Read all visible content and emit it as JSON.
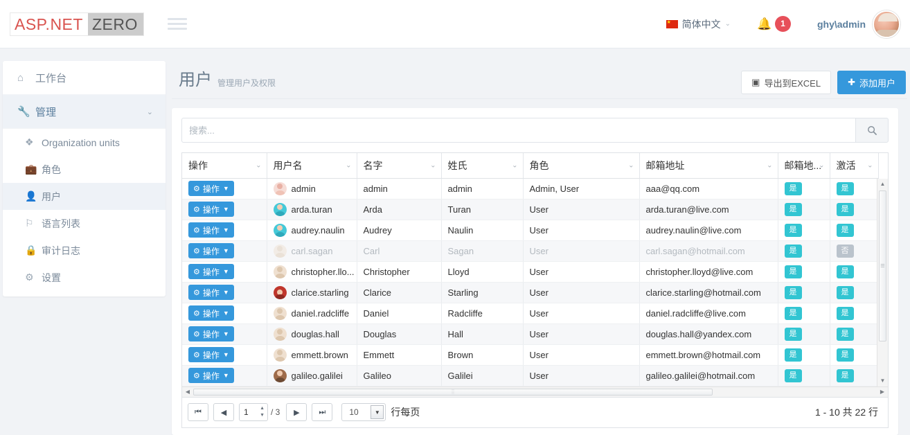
{
  "header": {
    "logo_primary": "ASP.NET",
    "logo_secondary": "ZERO",
    "menu_icon": "hamburger-icon",
    "language": {
      "label": "简体中文",
      "flag": "cn-flag-icon",
      "caret": "⌄"
    },
    "notifications": {
      "icon": "bell-icon",
      "count": "1"
    },
    "user": {
      "name": "ghy\\admin",
      "avatar": "user-avatar"
    }
  },
  "sidebar": {
    "items": [
      {
        "label": "工作台",
        "icon": "home-icon",
        "active": false
      },
      {
        "label": "管理",
        "icon": "wrench-icon",
        "active": true,
        "chevron": "⌄"
      }
    ],
    "subitems": [
      {
        "label": "Organization units",
        "icon": "layers-icon",
        "active": false
      },
      {
        "label": "角色",
        "icon": "briefcase-icon",
        "active": false
      },
      {
        "label": "用户",
        "icon": "users-icon",
        "active": true
      },
      {
        "label": "语言列表",
        "icon": "flag-icon",
        "active": false
      },
      {
        "label": "审计日志",
        "icon": "lock-icon",
        "active": false
      },
      {
        "label": "设置",
        "icon": "gear-icon",
        "active": false
      }
    ]
  },
  "page": {
    "title": "用户",
    "subtitle": "管理用户及权限",
    "export_button": "导出到EXCEL",
    "export_icon": "excel-icon",
    "add_button": "添加用户",
    "add_icon": "plus-icon"
  },
  "search": {
    "placeholder": "搜索...",
    "value": "",
    "button_icon": "search-icon"
  },
  "table": {
    "columns": [
      {
        "label": "操作",
        "key": "action",
        "chevron": "⌄"
      },
      {
        "label": "用户名",
        "key": "username",
        "chevron": "⌄"
      },
      {
        "label": "名字",
        "key": "firstname",
        "chevron": "⌄"
      },
      {
        "label": "姓氏",
        "key": "lastname",
        "chevron": "⌄"
      },
      {
        "label": "角色",
        "key": "roles",
        "chevron": "⌄"
      },
      {
        "label": "邮箱地址",
        "key": "email",
        "chevron": "⌄"
      },
      {
        "label": "邮箱地...",
        "key": "email_confirmed",
        "chevron": "⌄"
      },
      {
        "label": "激活",
        "key": "active",
        "chevron": "⌄"
      }
    ],
    "action_button_label": "操作",
    "rows": [
      {
        "username": "admin",
        "firstname": "admin",
        "lastname": "admin",
        "roles": "Admin, User",
        "email": "aaa@qq.com",
        "email_confirmed": "是",
        "active": "是",
        "avatar": "pink",
        "disabled": false
      },
      {
        "username": "arda.turan",
        "firstname": "Arda",
        "lastname": "Turan",
        "roles": "User",
        "email": "arda.turan@live.com",
        "email_confirmed": "是",
        "active": "是",
        "avatar": "teal",
        "disabled": false
      },
      {
        "username": "audrey.naulin",
        "firstname": "Audrey",
        "lastname": "Naulin",
        "roles": "User",
        "email": "audrey.naulin@live.com",
        "email_confirmed": "是",
        "active": "是",
        "avatar": "teal",
        "disabled": false
      },
      {
        "username": "carl.sagan",
        "firstname": "Carl",
        "lastname": "Sagan",
        "roles": "User",
        "email": "carl.sagan@hotmail.com",
        "email_confirmed": "是",
        "active": "否",
        "avatar": "default",
        "disabled": true
      },
      {
        "username": "christopher.llo...",
        "firstname": "Christopher",
        "lastname": "Lloyd",
        "roles": "User",
        "email": "christopher.lloyd@live.com",
        "email_confirmed": "是",
        "active": "是",
        "avatar": "default",
        "disabled": false
      },
      {
        "username": "clarice.starling",
        "firstname": "Clarice",
        "lastname": "Starling",
        "roles": "User",
        "email": "clarice.starling@hotmail.com",
        "email_confirmed": "是",
        "active": "是",
        "avatar": "red",
        "disabled": false
      },
      {
        "username": "daniel.radcliffe",
        "firstname": "Daniel",
        "lastname": "Radcliffe",
        "roles": "User",
        "email": "daniel.radcliffe@live.com",
        "email_confirmed": "是",
        "active": "是",
        "avatar": "default",
        "disabled": false
      },
      {
        "username": "douglas.hall",
        "firstname": "Douglas",
        "lastname": "Hall",
        "roles": "User",
        "email": "douglas.hall@yandex.com",
        "email_confirmed": "是",
        "active": "是",
        "avatar": "default",
        "disabled": false
      },
      {
        "username": "emmett.brown",
        "firstname": "Emmett",
        "lastname": "Brown",
        "roles": "User",
        "email": "emmett.brown@hotmail.com",
        "email_confirmed": "是",
        "active": "是",
        "avatar": "default",
        "disabled": false
      },
      {
        "username": "galileo.galilei",
        "firstname": "Galileo",
        "lastname": "Galilei",
        "roles": "User",
        "email": "galileo.galilei@hotmail.com",
        "email_confirmed": "是",
        "active": "是",
        "avatar": "brown",
        "disabled": false
      }
    ]
  },
  "pager": {
    "first_icon": "⏮",
    "prev_icon": "◀",
    "page_value": "1",
    "total_pages": "/ 3",
    "next_icon": "▶",
    "last_icon": "⏭",
    "page_size": "10",
    "page_size_label": "行每页",
    "range_text": "1 - 10 共 22 行"
  },
  "colors": {
    "accent": "#3598dc",
    "badge_yes": "#32c5d2",
    "badge_no": "#bac3cc",
    "notification": "#e7505a",
    "logo_red": "#d9534f"
  }
}
